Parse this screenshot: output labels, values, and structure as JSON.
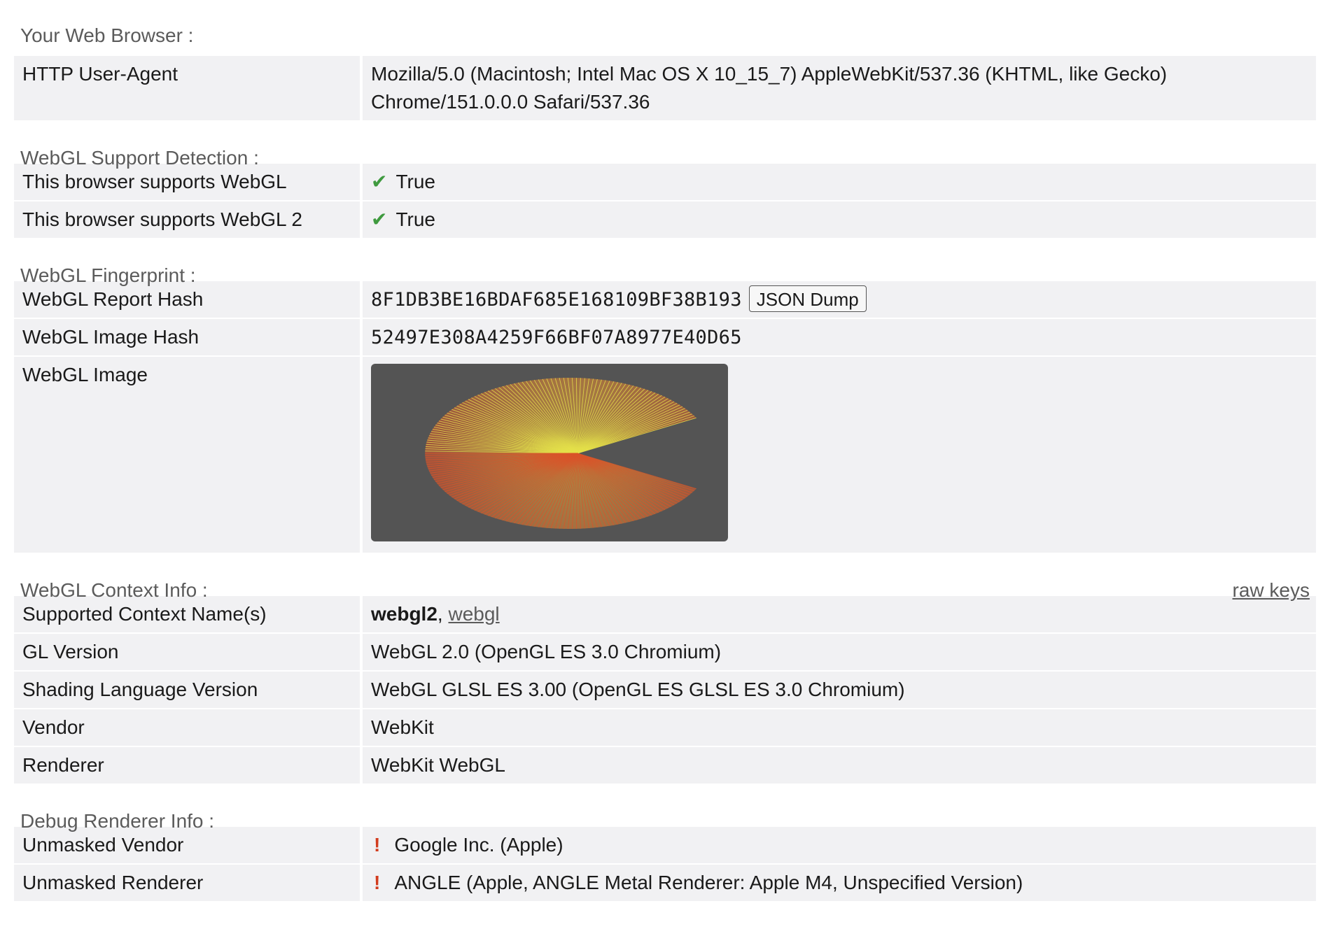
{
  "browser": {
    "title": "Your Web Browser :",
    "ua_label": "HTTP User-Agent",
    "ua_value": "Mozilla/5.0 (Macintosh; Intel Mac OS X 10_15_7) AppleWebKit/537.36 (KHTML, like Gecko) Chrome/151.0.0.0 Safari/537.36"
  },
  "support": {
    "title": "WebGL Support Detection :",
    "rows": [
      {
        "label": "This browser supports WebGL",
        "value": "True"
      },
      {
        "label": "This browser supports WebGL 2",
        "value": "True"
      }
    ],
    "check_glyph": "✔"
  },
  "fingerprint": {
    "title": "WebGL Fingerprint :",
    "report_hash_label": "WebGL Report Hash",
    "report_hash": "8F1DB3BE16BDAF685E168109BF38B193",
    "json_dump": "JSON Dump",
    "image_hash_label": "WebGL Image Hash",
    "image_hash": "52497E308A4259F66BF07A8977E40D65",
    "image_label": "WebGL Image"
  },
  "context": {
    "title": "WebGL Context Info :",
    "raw_keys": "raw keys",
    "names_label": "Supported Context Name(s)",
    "name_primary": "webgl2",
    "name_sep": ", ",
    "name_secondary": "webgl",
    "gl_version_label": "GL Version",
    "gl_version": "WebGL 2.0 (OpenGL ES 3.0 Chromium)",
    "slv_label": "Shading Language Version",
    "slv": "WebGL GLSL ES 3.00 (OpenGL ES GLSL ES 3.0 Chromium)",
    "vendor_label": "Vendor",
    "vendor": "WebKit",
    "renderer_label": "Renderer",
    "renderer": "WebKit WebGL"
  },
  "debug": {
    "title": "Debug Renderer Info :",
    "warn_glyph": "!",
    "unmasked_vendor_label": "Unmasked Vendor",
    "unmasked_vendor": "Google Inc. (Apple)",
    "unmasked_renderer_label": "Unmasked Renderer",
    "unmasked_renderer": "ANGLE (Apple, ANGLE Metal Renderer: Apple M4, Unspecified Version)"
  },
  "colors": {
    "row_bg": "#f1f1f3",
    "check": "#3f9a3f",
    "warn": "#d23c1e",
    "image_bg": "#545454",
    "fan_inner": "#f2c53a",
    "fan_outer_top": "#e4e04a",
    "fan_outer_bottom": "#d9542a"
  }
}
